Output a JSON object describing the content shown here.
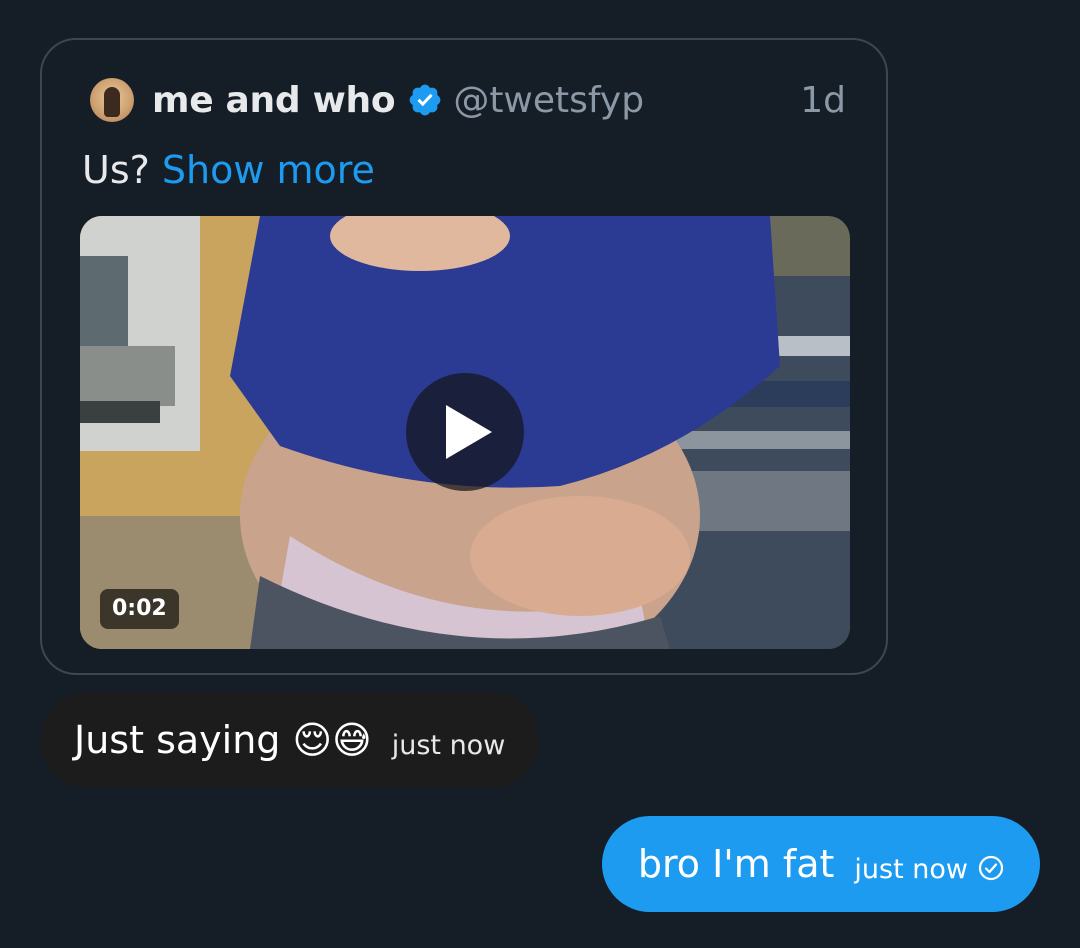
{
  "quoted_tweet": {
    "author_name": "me and who",
    "author_handle": "@twetsfyp",
    "age": "1d",
    "verified_icon": "verified-badge-icon",
    "text": "Us?",
    "show_more_label": "Show more",
    "video": {
      "duration": "0:02",
      "play_icon": "play-icon"
    }
  },
  "messages": [
    {
      "direction": "received",
      "text": "Just saying 😌😅",
      "time": "just now"
    },
    {
      "direction": "sent",
      "text": "bro I'm fat",
      "time": "just now",
      "status_icon": "sent-check-icon"
    }
  ],
  "colors": {
    "background": "#151d27",
    "accent": "#1d9bf0",
    "card_border": "#3b4753",
    "received_bubble": "#1c1c1d",
    "secondary_text": "#8b98a5"
  }
}
